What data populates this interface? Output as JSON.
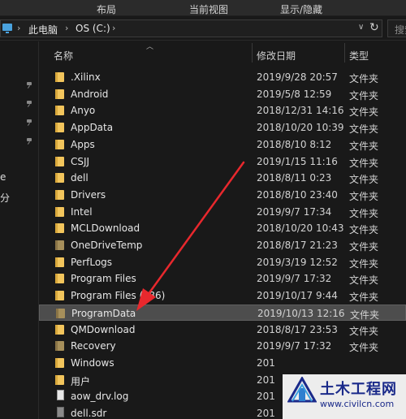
{
  "ribbon": {
    "tabs": [
      "布局",
      "当前视图",
      "显示/隐藏"
    ]
  },
  "address_bar": {
    "crumbs": [
      "此电脑",
      "OS (C:)"
    ],
    "search_placeholder": "搜索"
  },
  "nav_pane": {
    "fragments": [
      "e",
      "分"
    ]
  },
  "columns": {
    "name": "名称",
    "date": "修改日期",
    "type": "类型"
  },
  "files": [
    {
      "name": ".Xilinx",
      "date": "2019/9/28 20:57",
      "type": "文件夹",
      "icon": "folder-icon"
    },
    {
      "name": "Android",
      "date": "2019/5/8 12:59",
      "type": "文件夹",
      "icon": "folder-icon"
    },
    {
      "name": "Anyo",
      "date": "2018/12/31 14:16",
      "type": "文件夹",
      "icon": "folder-icon"
    },
    {
      "name": "AppData",
      "date": "2018/10/20 10:39",
      "type": "文件夹",
      "icon": "folder-icon"
    },
    {
      "name": "Apps",
      "date": "2018/8/10 8:12",
      "type": "文件夹",
      "icon": "folder-icon"
    },
    {
      "name": "CSJJ",
      "date": "2019/1/15 11:16",
      "type": "文件夹",
      "icon": "folder-icon"
    },
    {
      "name": "dell",
      "date": "2018/8/11 0:23",
      "type": "文件夹",
      "icon": "folder-icon"
    },
    {
      "name": "Drivers",
      "date": "2018/8/10 23:40",
      "type": "文件夹",
      "icon": "folder-icon"
    },
    {
      "name": "Intel",
      "date": "2019/9/7 17:34",
      "type": "文件夹",
      "icon": "folder-icon"
    },
    {
      "name": "MCLDownload",
      "date": "2018/10/20 10:43",
      "type": "文件夹",
      "icon": "folder-icon"
    },
    {
      "name": "OneDriveTemp",
      "date": "2018/8/17 21:23",
      "type": "文件夹",
      "icon": "folder-icon-dim"
    },
    {
      "name": "PerfLogs",
      "date": "2019/3/19 12:52",
      "type": "文件夹",
      "icon": "folder-icon"
    },
    {
      "name": "Program Files",
      "date": "2019/9/7 17:32",
      "type": "文件夹",
      "icon": "folder-icon"
    },
    {
      "name": "Program Files (x86)",
      "date": "2019/10/17 9:44",
      "type": "文件夹",
      "icon": "folder-icon"
    },
    {
      "name": "ProgramData",
      "date": "2019/10/13 12:16",
      "type": "文件夹",
      "icon": "folder-icon-dim"
    },
    {
      "name": "QMDownload",
      "date": "2018/8/17 23:53",
      "type": "文件夹",
      "icon": "folder-icon"
    },
    {
      "name": "Recovery",
      "date": "2019/9/7 17:32",
      "type": "文件夹",
      "icon": "folder-icon-dim"
    },
    {
      "name": "Windows",
      "date": "201",
      "type": "",
      "icon": "folder-icon"
    },
    {
      "name": "用户",
      "date": "201",
      "type": "",
      "icon": "folder-icon"
    },
    {
      "name": "aow_drv.log",
      "date": "201",
      "type": "",
      "icon": "file-icon"
    },
    {
      "name": "dell.sdr",
      "date": "201",
      "type": "",
      "icon": "file-icon-gray"
    }
  ],
  "selected_row": "ProgramData",
  "watermark": {
    "title": "土木工程网",
    "url": "www.civilcn.com"
  },
  "colors": {
    "background": "#191919",
    "folder": "#f2c55c",
    "selected": "#4d4d4d",
    "arrow": "#e8282d",
    "watermark_text": "#1a2a8a"
  }
}
